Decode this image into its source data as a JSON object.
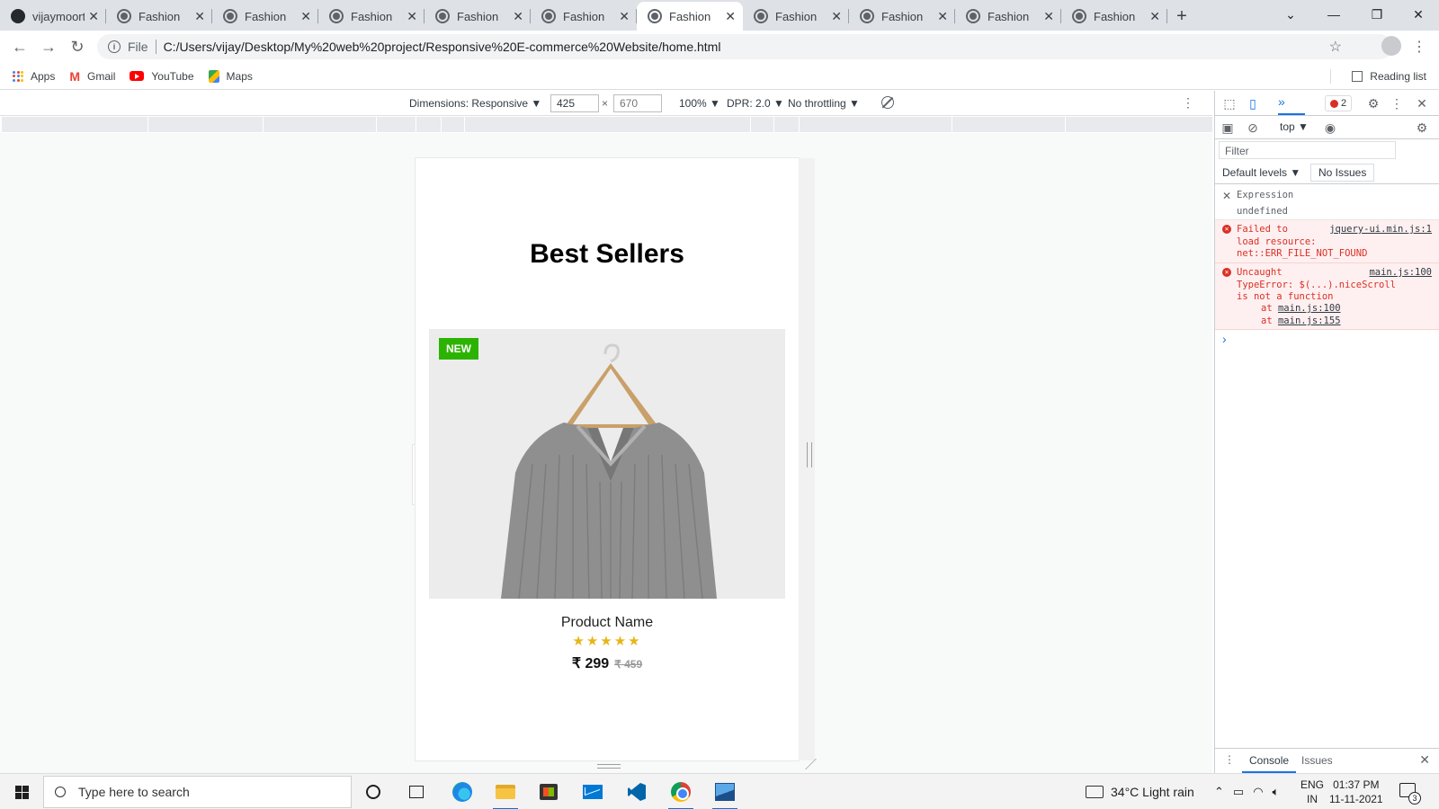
{
  "browser": {
    "tabs": [
      {
        "title": "vijaymoorthy",
        "active": false,
        "icon": "github-icon"
      },
      {
        "title": "Fashion",
        "active": false,
        "icon": "globe-icon"
      },
      {
        "title": "Fashion",
        "active": false,
        "icon": "globe-icon"
      },
      {
        "title": "Fashion",
        "active": false,
        "icon": "globe-icon"
      },
      {
        "title": "Fashion",
        "active": false,
        "icon": "globe-icon"
      },
      {
        "title": "Fashion",
        "active": false,
        "icon": "globe-icon"
      },
      {
        "title": "Fashion",
        "active": true,
        "icon": "globe-icon"
      },
      {
        "title": "Fashion",
        "active": false,
        "icon": "globe-icon"
      },
      {
        "title": "Fashion",
        "active": false,
        "icon": "globe-icon"
      },
      {
        "title": "Fashion",
        "active": false,
        "icon": "globe-icon"
      },
      {
        "title": "Fashion",
        "active": false,
        "icon": "globe-icon"
      }
    ],
    "address": {
      "scheme": "File",
      "url": "C:/Users/vijay/Desktop/My%20web%20project/Responsive%20E-commerce%20Website/home.html"
    },
    "bookmarks": [
      {
        "label": "Apps",
        "icon": "apps-grid-icon"
      },
      {
        "label": "Gmail",
        "icon": "gmail-icon"
      },
      {
        "label": "YouTube",
        "icon": "youtube-icon"
      },
      {
        "label": "Maps",
        "icon": "maps-icon"
      }
    ],
    "reading_list": "Reading list"
  },
  "device_toolbar": {
    "dimensions_label": "Dimensions: Responsive ▼",
    "width": "425",
    "height": "670",
    "times": "×",
    "zoom": "100% ▼",
    "dpr": "DPR: 2.0 ▼",
    "throttling": "No throttling ▼"
  },
  "page": {
    "heading": "Best Sellers",
    "badge": "NEW",
    "product_name": "Product Name",
    "rating": 5,
    "stars": "★★★★★",
    "price": "₹ 299",
    "old_price": "₹ 459",
    "colors": {
      "badge": "#2cb302",
      "stars": "#e7b518"
    }
  },
  "devtools": {
    "error_count": "2",
    "context": "top ▼",
    "filter_placeholder": "Filter",
    "levels": "Default levels ▼",
    "issues": "No Issues",
    "expression_label": "Expression",
    "expression_value": "undefined",
    "errors": [
      {
        "text": "Failed to\nload resource:\nnet::ERR_FILE_NOT_FOUND",
        "source": "jquery-ui.min.js:1"
      },
      {
        "text": "Uncaught\nTypeError: $(...).niceScroll\nis not a function",
        "source": "main.js:100",
        "stack": [
          "main.js:100",
          "main.js:155"
        ],
        "stack_prefix": "at"
      }
    ],
    "drawer_tabs": [
      "Console",
      "Issues"
    ]
  },
  "taskbar": {
    "search_placeholder": "Type here to search",
    "weather": "34°C  Light rain",
    "lang_top": "ENG",
    "lang_bottom": "IN",
    "time": "01:37 PM",
    "date": "11-11-2021",
    "notification_count": "3"
  }
}
